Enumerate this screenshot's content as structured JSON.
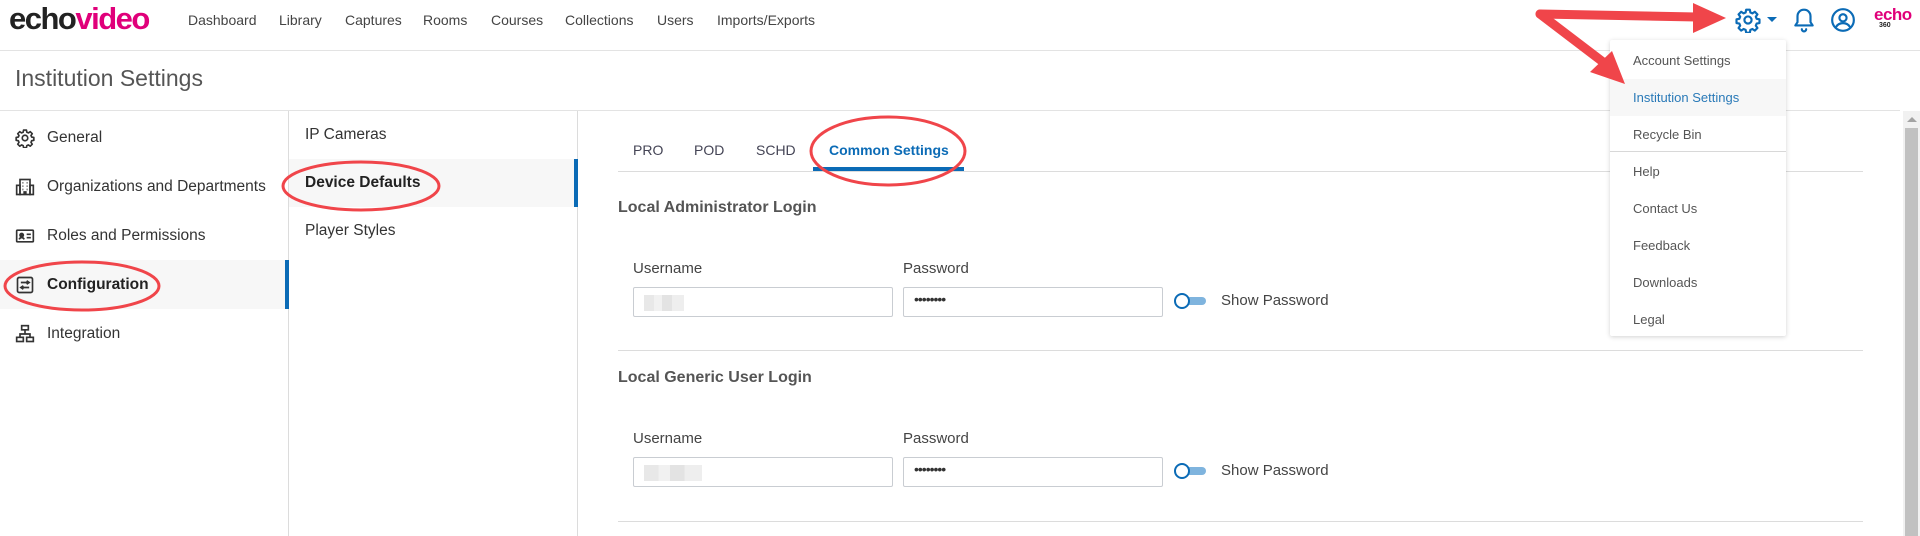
{
  "brand": {
    "logo_part1": "echo",
    "logo_part2": "video",
    "corner_logo_top": "echo",
    "corner_logo_bottom": "360"
  },
  "nav": {
    "links": [
      "Dashboard",
      "Library",
      "Captures",
      "Rooms",
      "Courses",
      "Collections",
      "Users",
      "Imports/Exports"
    ],
    "icons": [
      "gear-icon",
      "caret-down-icon",
      "bell-icon",
      "user-circle-icon"
    ]
  },
  "settings_menu": {
    "items": [
      "Account Settings",
      "Institution Settings",
      "Recycle Bin",
      "Help",
      "Contact Us",
      "Feedback",
      "Downloads",
      "Legal"
    ],
    "highlighted": "Institution Settings"
  },
  "page": {
    "title": "Institution Settings"
  },
  "sidebar": {
    "items": [
      {
        "label": "General",
        "icon": "gear-icon"
      },
      {
        "label": "Organizations and Departments",
        "icon": "building-icon"
      },
      {
        "label": "Roles and Permissions",
        "icon": "id-card-icon"
      },
      {
        "label": "Configuration",
        "icon": "sliders-icon"
      },
      {
        "label": "Integration",
        "icon": "network-icon"
      }
    ],
    "active": "Configuration"
  },
  "subnav": {
    "items": [
      "IP Cameras",
      "Device Defaults",
      "Player Styles"
    ],
    "active": "Device Defaults"
  },
  "tabs": {
    "items": [
      "PRO",
      "POD",
      "SCHD",
      "Common Settings"
    ],
    "active": "Common Settings"
  },
  "sections": [
    {
      "title": "Local Administrator Login",
      "username_label": "Username",
      "username_value": "",
      "password_label": "Password",
      "password_value": "••••••••",
      "toggle_label": "Show Password",
      "show_password": false
    },
    {
      "title": "Local Generic User Login",
      "username_label": "Username",
      "username_value": "",
      "password_label": "Password",
      "password_value": "••••••••",
      "toggle_label": "Show Password",
      "show_password": false
    }
  ],
  "colors": {
    "accent": "#0b6bb6",
    "brand": "#e0007a",
    "annotation": "#f0454a"
  }
}
